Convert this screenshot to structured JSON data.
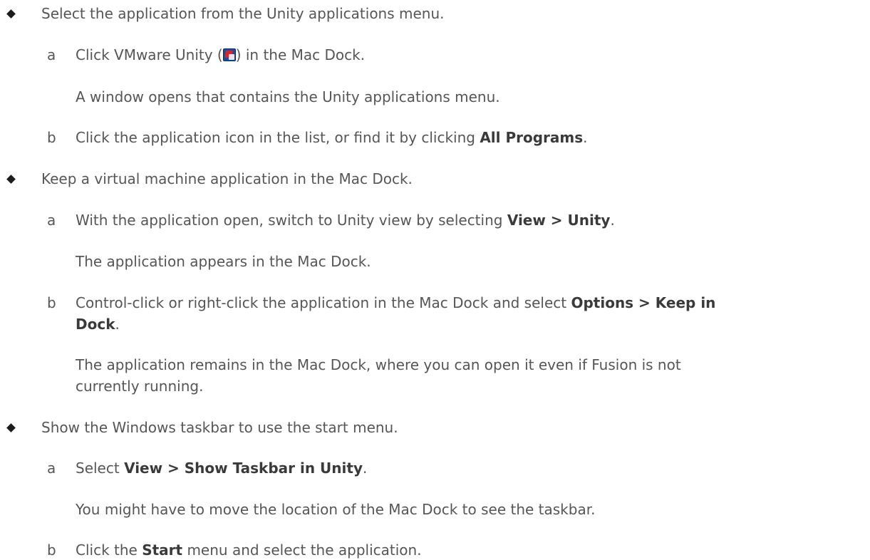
{
  "items": [
    {
      "bullet_text": "Select the application from the Unity applications menu.",
      "steps": [
        {
          "letter": "a",
          "text_before": "Click VMware Unity (",
          "icon": "vmware-unity-icon",
          "text_after": ") in the Mac Dock.",
          "result": "A window opens that contains the Unity applications menu."
        },
        {
          "letter": "b",
          "text_before": "Click the application icon in the list, or find it by clicking ",
          "bold": "All Programs",
          "text_after": "."
        }
      ]
    },
    {
      "bullet_text": "Keep a virtual machine application in the Mac Dock.",
      "steps": [
        {
          "letter": "a",
          "text_before": "With the application open, switch to Unity view by selecting ",
          "bold": "View > Unity",
          "text_after": ".",
          "result": "The application appears in the Mac Dock."
        },
        {
          "letter": "b",
          "text_before": "Control-click or right-click the application in the Mac Dock and select ",
          "bold": "Options > Keep in",
          "bold_line2": "Dock",
          "text_after": ".",
          "result_line1": "The application remains in the Mac Dock, where you can open it even if Fusion is not",
          "result_line2": "currently running."
        }
      ]
    },
    {
      "bullet_text": "Show the Windows taskbar to use the start menu.",
      "steps": [
        {
          "letter": "a",
          "text_before": "Select ",
          "bold": "View > Show Taskbar in Unity",
          "text_after": ".",
          "result": "You might have to move the location of the Mac Dock to see the taskbar."
        },
        {
          "letter": "b",
          "text_before": "Click the ",
          "bold": "Start",
          "text_after": " menu and select the application."
        }
      ]
    }
  ]
}
